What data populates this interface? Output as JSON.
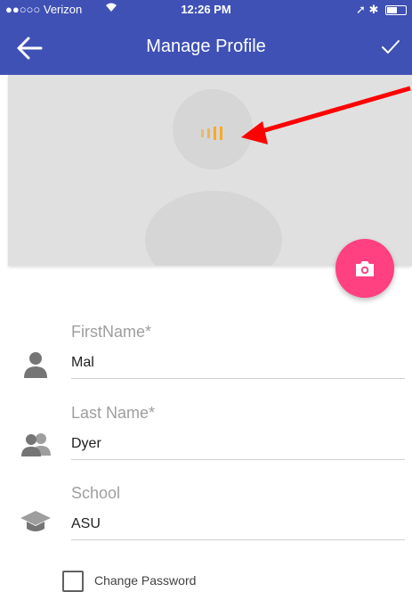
{
  "status_bar": {
    "carrier": "●●○○○ Verizon",
    "time": "12:26 PM",
    "battery_level": 0.55
  },
  "app_bar": {
    "title": "Manage Profile",
    "back_icon": "arrow-left-icon",
    "confirm_icon": "check-icon",
    "color": "#3f51b5"
  },
  "avatar": {
    "placeholder_icon": "person-silhouette-icon",
    "loading_icon": "loading-bars-icon",
    "camera_icon": "camera-icon",
    "fab_color": "#ff4081",
    "annotation_color": "#ff0000"
  },
  "form": {
    "first_name": {
      "label": "FirstName*",
      "value": "Mal",
      "icon": "person-icon"
    },
    "last_name": {
      "label": "Last Name*",
      "value": "Dyer",
      "icon": "people-icon"
    },
    "school": {
      "label": "School",
      "value": "ASU",
      "icon": "graduation-cap-icon"
    },
    "change_password": {
      "label": "Change Password",
      "checked": false
    }
  }
}
